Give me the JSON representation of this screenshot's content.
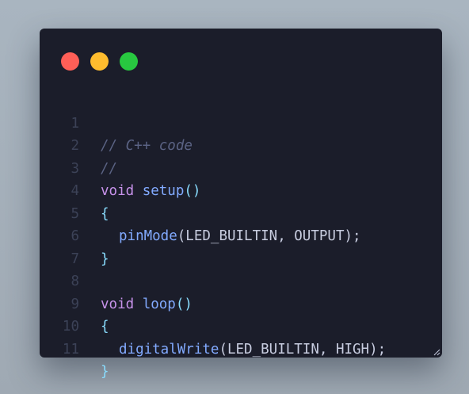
{
  "window": {
    "traffic_lights": [
      {
        "name": "close",
        "color": "#ff5f57"
      },
      {
        "name": "minimize",
        "color": "#febc2e"
      },
      {
        "name": "maximize",
        "color": "#28c840"
      }
    ]
  },
  "code": {
    "lines": [
      {
        "num": "1",
        "comment": "// C++ code"
      },
      {
        "num": "2",
        "comment": "//"
      },
      {
        "num": "3",
        "kw": "void",
        "fn": "setup",
        "punc": "()"
      },
      {
        "num": "4",
        "brace": "{"
      },
      {
        "num": "5",
        "fn": "pinMode",
        "args": "(LED_BUILTIN, OUTPUT);"
      },
      {
        "num": "6",
        "brace": "}"
      },
      {
        "num": "7"
      },
      {
        "num": "8",
        "kw": "void",
        "fn": "loop",
        "punc": "()"
      },
      {
        "num": "9",
        "brace": "{"
      },
      {
        "num": "10",
        "fn": "digitalWrite",
        "args": "(LED_BUILTIN, HIGH);"
      },
      {
        "num": "11",
        "brace": "}"
      }
    ]
  },
  "colors": {
    "background": "#1b1d2a",
    "comment": "#5b6384",
    "keyword": "#c792ea",
    "function": "#82aaff",
    "punctuation": "#89ddff",
    "line_number": "#3c4257"
  }
}
